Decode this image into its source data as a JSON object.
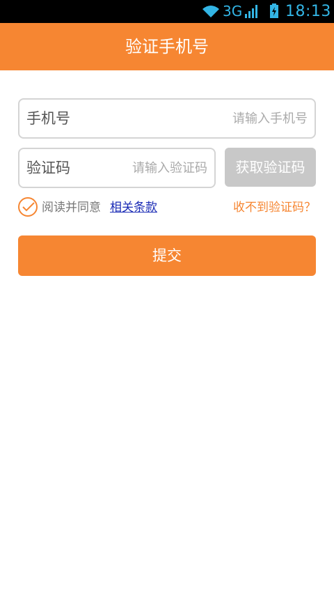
{
  "status_bar": {
    "network": "3G",
    "time": "18:13",
    "wifi_icon": "wifi-icon",
    "signal_icon": "signal-icon",
    "battery_icon": "battery-charging-icon"
  },
  "header": {
    "title": "验证手机号"
  },
  "phone": {
    "label": "手机号",
    "placeholder": "请输入手机号",
    "value": ""
  },
  "code": {
    "label": "验证码",
    "placeholder": "请输入验证码",
    "value": ""
  },
  "get_code_button": {
    "label": "获取验证码",
    "state": "disabled"
  },
  "agreement": {
    "checked": true,
    "text": "阅读并同意",
    "link_text": "相关条款"
  },
  "no_code_link": "收不到验证码？",
  "submit_button": {
    "label": "提交"
  },
  "colors": {
    "accent": "#f68632",
    "disabled": "#c8c8c8",
    "link": "#1a2bb5",
    "status_icon": "#33b5e5"
  }
}
